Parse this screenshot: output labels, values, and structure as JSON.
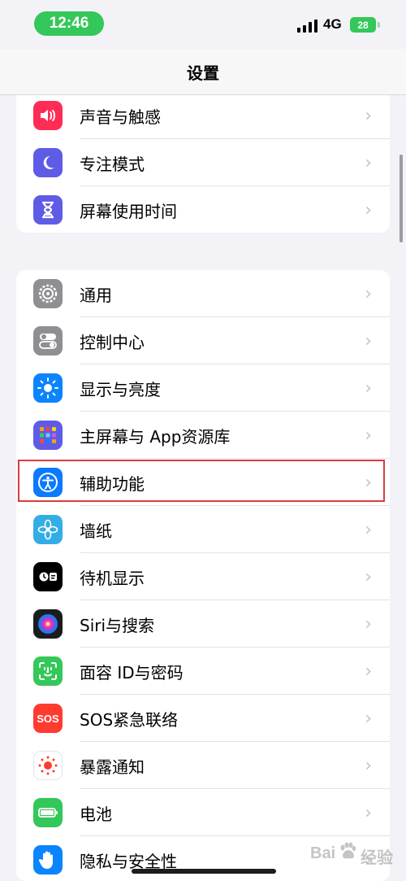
{
  "status_bar": {
    "time": "12:46",
    "network": "4G",
    "battery": "28"
  },
  "nav": {
    "title": "设置"
  },
  "group1": {
    "items": [
      {
        "label": "声音与触感",
        "icon": "speaker-icon",
        "color": "#ff2d55"
      },
      {
        "label": "专注模式",
        "icon": "moon-icon",
        "color": "#5e5ce6"
      },
      {
        "label": "屏幕使用时间",
        "icon": "hourglass-icon",
        "color": "#5e5ce6"
      }
    ]
  },
  "group2": {
    "items": [
      {
        "label": "通用",
        "icon": "gear-icon",
        "color": "#8e8e93"
      },
      {
        "label": "控制中心",
        "icon": "toggles-icon",
        "color": "#8e8e93"
      },
      {
        "label": "显示与亮度",
        "icon": "sun-icon",
        "color": "#0a84ff"
      },
      {
        "label": "主屏幕与 App资源库",
        "icon": "app-grid-icon",
        "color": "#5e5ce6"
      },
      {
        "label": "辅助功能",
        "icon": "accessibility-icon",
        "color": "#0a7aff"
      },
      {
        "label": "墙纸",
        "icon": "flower-icon",
        "color": "#32ade6"
      },
      {
        "label": "待机显示",
        "icon": "standby-icon",
        "color": "#000000"
      },
      {
        "label": "Siri与搜索",
        "icon": "siri-icon",
        "color": "#1c1c1e"
      },
      {
        "label": "面容 ID与密码",
        "icon": "face-id-icon",
        "color": "#34c759"
      },
      {
        "label": "SOS紧急联络",
        "icon": "sos-icon",
        "color": "#ff3b30",
        "icon_text": "SOS"
      },
      {
        "label": "暴露通知",
        "icon": "exposure-icon",
        "color": "#ffffff"
      },
      {
        "label": "电池",
        "icon": "battery-icon",
        "color": "#34c759"
      },
      {
        "label": "隐私与安全性",
        "icon": "hand-icon",
        "color": "#0a84ff"
      }
    ]
  },
  "chevron": "›",
  "highlight_color": "#e03a3a"
}
